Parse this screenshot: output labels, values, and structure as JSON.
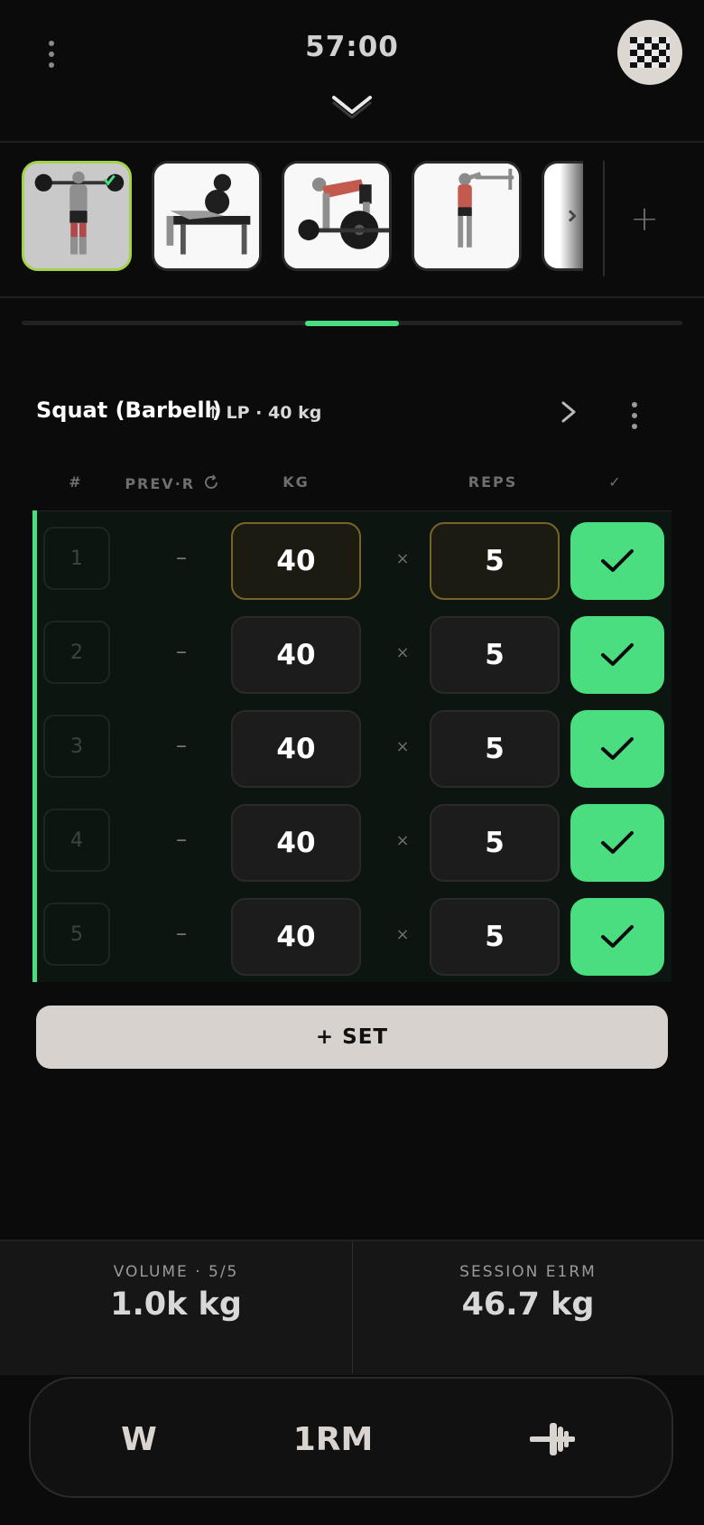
{
  "header": {
    "timer": "57:00"
  },
  "exercises": [
    {
      "name": "Squat (Barbell)",
      "active": true
    },
    {
      "name": "Bench Press"
    },
    {
      "name": "Bent Over Row"
    },
    {
      "name": "Pull Up"
    },
    {
      "name": "More"
    }
  ],
  "exercise": {
    "name": "Squat (Barbell)",
    "meta": "↑ LP · 40 kg"
  },
  "columns": {
    "num": "#",
    "prev": "PREV·R",
    "kg": "KG",
    "reps": "REPS",
    "done": "✓"
  },
  "sets": [
    {
      "num": "1",
      "prev": "–",
      "kg": "40",
      "x": "×",
      "reps": "5",
      "done": true
    },
    {
      "num": "2",
      "prev": "–",
      "kg": "40",
      "x": "×",
      "reps": "5",
      "done": true
    },
    {
      "num": "3",
      "prev": "–",
      "kg": "40",
      "x": "×",
      "reps": "5",
      "done": true
    },
    {
      "num": "4",
      "prev": "–",
      "kg": "40",
      "x": "×",
      "reps": "5",
      "done": true
    },
    {
      "num": "5",
      "prev": "–",
      "kg": "40",
      "x": "×",
      "reps": "5",
      "done": true
    }
  ],
  "add_set_label": "+ SET",
  "stats": {
    "volume_label": "VOLUME · 5/5",
    "volume_value": "1.0k kg",
    "e1rm_label": "SESSION E1RM",
    "e1rm_value": "46.7 kg"
  },
  "dock": {
    "warmup": "W",
    "onerm": "1RM",
    "plates_icon": "barbell-plates-icon"
  },
  "colors": {
    "accent": "#4ade80",
    "highlight_border": "#7a6328",
    "active_thumb_border": "#a4d24b"
  }
}
